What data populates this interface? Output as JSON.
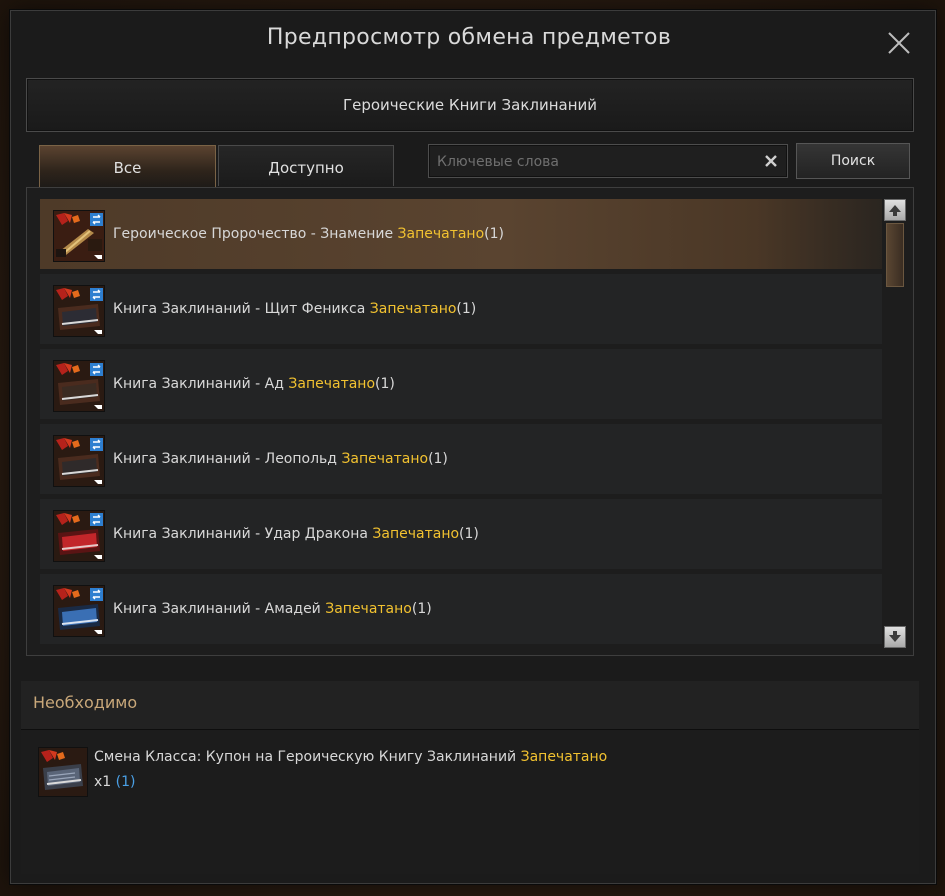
{
  "window": {
    "title": "Предпросмотр обмена предметов"
  },
  "category": {
    "label": "Героические Книги Заклинаний"
  },
  "tabs": [
    {
      "label": "Все",
      "active": true
    },
    {
      "label": "Доступно",
      "active": false
    }
  ],
  "search": {
    "placeholder": "Ключевые слова",
    "value": "",
    "button_label": "Поиск"
  },
  "items": [
    {
      "name": "Героическое Пророчество - Знамение",
      "status": "Запечатано",
      "count": "(1)",
      "icon": "prophecy-scroll-icon",
      "selected": true
    },
    {
      "name": "Книга Заклинаний - Щит Феникса",
      "status": "Запечатано",
      "count": "(1)",
      "icon": "spellbook-icon",
      "selected": false
    },
    {
      "name": "Книга Заклинаний - Ад",
      "status": "Запечатано",
      "count": "(1)",
      "icon": "spellbook-icon",
      "selected": false
    },
    {
      "name": "Книга Заклинаний - Леопольд",
      "status": "Запечатано",
      "count": "(1)",
      "icon": "spellbook-icon",
      "selected": false
    },
    {
      "name": "Книга Заклинаний - Удар Дракона",
      "status": "Запечатано",
      "count": "(1)",
      "icon": "spellbook-red-icon",
      "selected": false
    },
    {
      "name": "Книга Заклинаний - Амадей",
      "status": "Запечатано",
      "count": "(1)",
      "icon": "spellbook-blue-icon",
      "selected": false
    }
  ],
  "required": {
    "title": "Необходимо",
    "item_name": "Смена Класса: Купон на Героическую Книгу Заклинаний",
    "item_status": "Запечатано",
    "quantity": "x1",
    "owned": "(1)"
  },
  "colors": {
    "sealed": "#f2c230",
    "owned": "#4aa0e6",
    "section_title": "#c9a87a",
    "selected_row": "#5a4430"
  }
}
